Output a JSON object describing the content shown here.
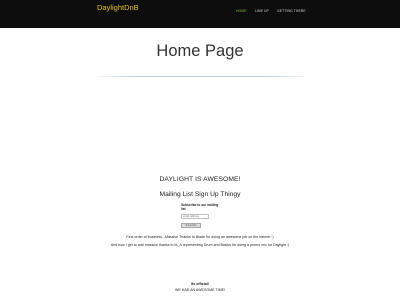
{
  "header": {
    "brand": "DaylightDnB",
    "nav": [
      {
        "label": "HOME",
        "active": true
      },
      {
        "label": "LINE UP",
        "active": false
      },
      {
        "label": "GETTING THERE",
        "active": false
      }
    ],
    "colors": {
      "bar": "#0d0d0d",
      "brand": "#e8c21a",
      "active": "#7ec23a"
    }
  },
  "hero": {
    "title": "Home Page"
  },
  "main": {
    "headline": "DAYLIGHT IS AWESOME!",
    "subheadline": "Mailing List Sign Up Thingy",
    "signup": {
      "label": "Subscribe to our mailing list",
      "placeholder": "email address",
      "button": "Subscribe"
    },
    "paragraphs": [
      "First order of business...Massive Thanks to Blade for doing an awesome job on the banner :)",
      "And now I get to add massive thanks to M_A representing Drum and Basics for doing a promo mix for Daylight :)"
    ]
  },
  "footer": {
    "line1": "Its official!",
    "line2": "WE HAD AN AWESOME TIME!"
  }
}
